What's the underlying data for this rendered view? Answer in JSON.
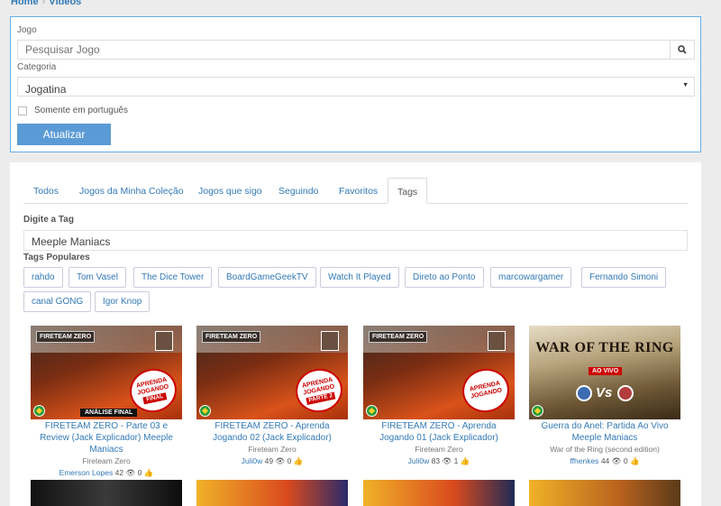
{
  "breadcrumb": {
    "home": "Home",
    "current": "Vídeos"
  },
  "filters": {
    "game_label": "Jogo",
    "game_placeholder": "Pesquisar Jogo",
    "category_label": "Categoria",
    "category_value": "Jogatina",
    "portuguese_only_label": "Somente em português",
    "update_button": "Atualizar"
  },
  "tabs": [
    {
      "label": "Todos"
    },
    {
      "label": "Jogos da Minha Coleção"
    },
    {
      "label": "Jogos que sigo"
    },
    {
      "label": "Seguindo"
    },
    {
      "label": "Favoritos"
    },
    {
      "label": "Tags"
    }
  ],
  "tag_search": {
    "label": "Digite a Tag",
    "value": "Meeple Maniacs"
  },
  "popular_tags": {
    "label": "Tags Populares",
    "items": [
      "rahdo",
      "Tom Vasel",
      "The Dice Tower",
      "BoardGameGeekTV",
      "Watch It Played",
      "Direto ao Ponto",
      "marcowargamer",
      "Fernando Simoni",
      "canal GONG",
      "Igor Knop"
    ]
  },
  "videos": [
    {
      "title": "FIRETEAM ZERO - Parte 03 e Review (Jack Explicador) Meeple Maniacs",
      "game": "Fireteam Zero",
      "user": "Emerson Lopes",
      "views": "42",
      "likes": "0",
      "sticker_line1": "APRENDA",
      "sticker_line2": "JOGANDO",
      "sticker_line3": "FINAL",
      "overlay": "ANÁLISE FINAL",
      "brand": "FIRETEAM ZERO"
    },
    {
      "title": "FIRETEAM ZERO - Aprenda Jogando 02 (Jack Explicador)",
      "game": "Fireteam Zero",
      "user": "Juli0w",
      "views": "49",
      "likes": "0",
      "sticker_line1": "APRENDA",
      "sticker_line2": "JOGANDO",
      "sticker_line3": "PARTE 2",
      "brand": "FIRETEAM ZERO"
    },
    {
      "title": "FIRETEAM ZERO - Aprenda Jogando 01 (Jack Explicador)",
      "game": "Fireteam Zero",
      "user": "Juli0w",
      "views": "83",
      "likes": "1",
      "sticker_line1": "APRENDA",
      "sticker_line2": "JOGANDO",
      "brand": "FIRETEAM ZERO"
    },
    {
      "title": "Guerra do Anel: Partida Ao Vivo Meeple Maniacs",
      "game": "War of the Ring (second edition)",
      "user": "ffhenkes",
      "views": "44",
      "likes": "0",
      "logo": "WAR OF THE RING",
      "live": "AO VIVO",
      "vs": "Vs"
    }
  ],
  "colors": {
    "accent": "#337ab7",
    "button": "#5b9bd5",
    "focus_border": "#66afe9"
  },
  "icons": {
    "search": "search-icon",
    "views": "eye-icon",
    "likes": "thumbs-up-icon"
  }
}
